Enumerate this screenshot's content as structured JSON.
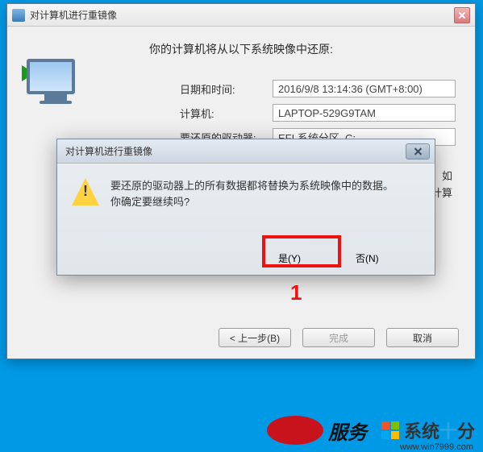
{
  "main_window": {
    "title": "对计算机进行重镜像",
    "heading": "你的计算机将从以下系统映像中还原:",
    "rows": [
      {
        "label": "日期和时间:",
        "value": "2016/9/8 13:14:36 (GMT+8:00)"
      },
      {
        "label": "计算机:",
        "value": "LAPTOP-529G9TAM"
      },
      {
        "label": "要还原的驱动器:",
        "value": "EFI 系统分区, C:"
      }
    ],
    "body_text_l1": "机。如",
    "body_text_l2": "原计算",
    "buttons": {
      "back": "< 上一步(B)",
      "finish": "完成",
      "cancel": "取消"
    }
  },
  "dialog": {
    "title": "对计算机进行重镜像",
    "message_l1": "要还原的驱动器上的所有数据都将替换为系统映像中的数据。",
    "message_l2": "你确定要继续吗?",
    "yes": "是(Y)",
    "no": "否(N)"
  },
  "annotations": {
    "red_number": "1"
  },
  "overlays": {
    "fuwu": "服务",
    "system_brand_1": "系统",
    "system_brand_2": "十",
    "system_brand_3": "分",
    "url": "www.win7999.com"
  }
}
